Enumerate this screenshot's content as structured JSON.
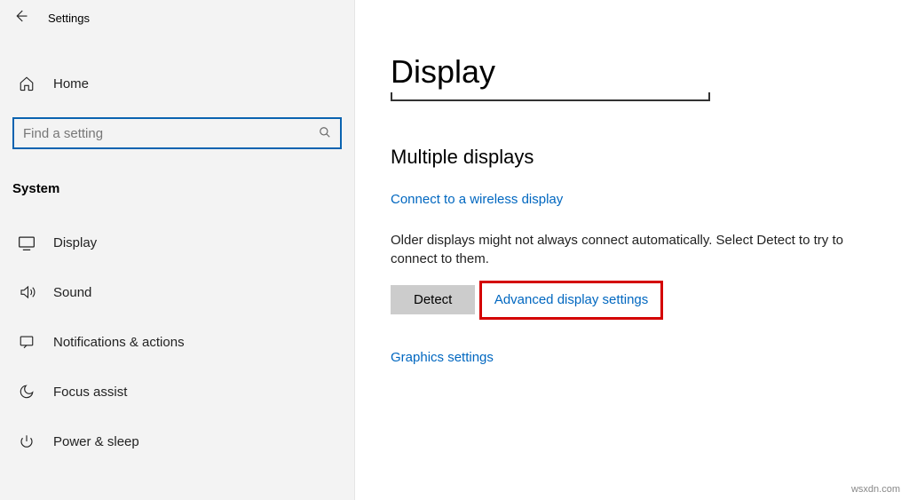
{
  "topbar": {
    "title": "Settings"
  },
  "sidebar": {
    "home": "Home",
    "search_placeholder": "Find a setting",
    "section": "System",
    "items": [
      {
        "label": "Display"
      },
      {
        "label": "Sound"
      },
      {
        "label": "Notifications & actions"
      },
      {
        "label": "Focus assist"
      },
      {
        "label": "Power & sleep"
      }
    ]
  },
  "main": {
    "title": "Display",
    "subheading": "Multiple displays",
    "wireless_link": "Connect to a wireless display",
    "detect_text": "Older displays might not always connect automatically. Select Detect to try to connect to them.",
    "detect_button": "Detect",
    "advanced_link": "Advanced display settings",
    "graphics_link": "Graphics settings"
  },
  "watermark": "wsxdn.com"
}
